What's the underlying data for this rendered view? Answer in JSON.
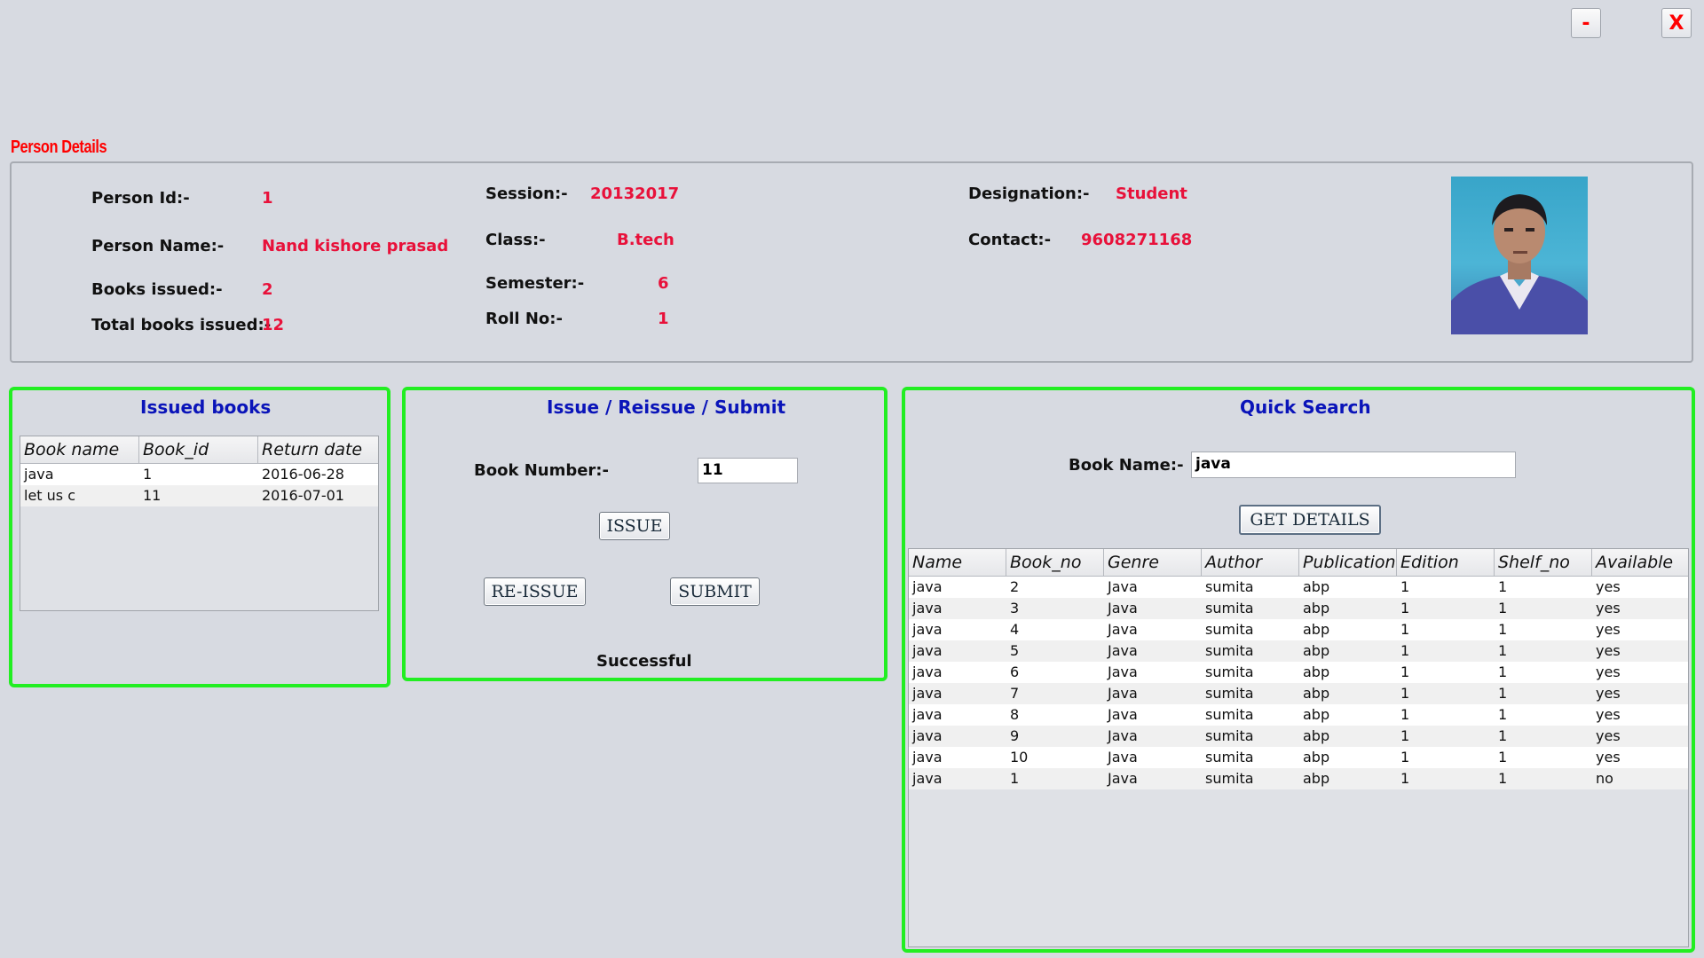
{
  "window": {
    "minimize_label": "-",
    "close_label": "X"
  },
  "person": {
    "section_title": "Person Details",
    "id_label": "Person Id:-",
    "id_value": "1",
    "name_label": "Person Name:-",
    "name_value": "Nand kishore prasad",
    "books_issued_label": "Books issued:-",
    "books_issued_value": "2",
    "total_issued_label": "Total books issued:-",
    "total_issued_value": "12",
    "session_label": "Session:-",
    "session_value": "20132017",
    "class_label": "Class:-",
    "class_value": "B.tech",
    "semester_label": "Semester:-",
    "semester_value": "6",
    "roll_label": "Roll No:-",
    "roll_value": "1",
    "designation_label": "Designation:-",
    "designation_value": "Student",
    "contact_label": "Contact:-",
    "contact_value": "9608271168"
  },
  "issued": {
    "title": "Issued books",
    "columns": [
      "Book name",
      "Book_id",
      "Return date"
    ],
    "rows": [
      [
        "java",
        "1",
        "2016-06-28"
      ],
      [
        "let us c",
        "11",
        "2016-07-01"
      ]
    ]
  },
  "issue_panel": {
    "title": "Issue / Reissue / Submit",
    "book_number_label": "Book Number:-",
    "book_number_value": "11",
    "issue_label": "ISSUE",
    "reissue_label": "RE-ISSUE",
    "submit_label": "SUBMIT",
    "status": "Successful"
  },
  "search": {
    "title": "Quick Search",
    "book_name_label": "Book Name:-",
    "book_name_value": "java",
    "get_details_label": "GET DETAILS",
    "columns": [
      "Name",
      "Book_no",
      "Genre",
      "Author",
      "Publication",
      "Edition",
      "Shelf_no",
      "Available"
    ],
    "rows": [
      [
        "java",
        "2",
        "Java",
        "sumita",
        "abp",
        "1",
        "1",
        "yes"
      ],
      [
        "java",
        "3",
        "Java",
        "sumita",
        "abp",
        "1",
        "1",
        "yes"
      ],
      [
        "java",
        "4",
        "Java",
        "sumita",
        "abp",
        "1",
        "1",
        "yes"
      ],
      [
        "java",
        "5",
        "Java",
        "sumita",
        "abp",
        "1",
        "1",
        "yes"
      ],
      [
        "java",
        "6",
        "Java",
        "sumita",
        "abp",
        "1",
        "1",
        "yes"
      ],
      [
        "java",
        "7",
        "Java",
        "sumita",
        "abp",
        "1",
        "1",
        "yes"
      ],
      [
        "java",
        "8",
        "Java",
        "sumita",
        "abp",
        "1",
        "1",
        "yes"
      ],
      [
        "java",
        "9",
        "Java",
        "sumita",
        "abp",
        "1",
        "1",
        "yes"
      ],
      [
        "java",
        "10",
        "Java",
        "sumita",
        "abp",
        "1",
        "1",
        "yes"
      ],
      [
        "java",
        "1",
        "Java",
        "sumita",
        "abp",
        "1",
        "1",
        "no"
      ]
    ]
  }
}
